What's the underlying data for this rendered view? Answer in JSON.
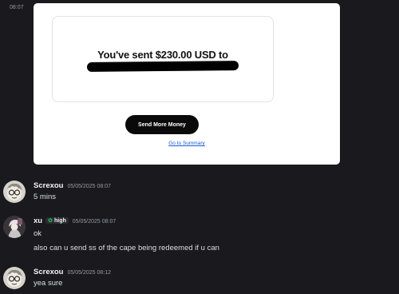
{
  "attachment": {
    "gutter_time": "08:07",
    "sent_text": "You've sent $230.00 USD to",
    "send_more_label": "Send More Money",
    "summary_link": "Go to Summary",
    "icon": "app-grid-icon"
  },
  "messages": [
    {
      "author": "Screxou",
      "timestamp": "05/05/2025 08:07",
      "lines": [
        "5 mins"
      ]
    },
    {
      "author": "xu",
      "tag": "high",
      "timestamp": "05/05/2025 08:07",
      "lines": [
        "ok",
        "also can u send ss of the cape being redeemed if u can"
      ]
    },
    {
      "author": "Screxou",
      "timestamp": "05/05/2025 08:12",
      "lines": [
        "yea sure"
      ]
    }
  ],
  "colors": {
    "background": "#1a1a1e",
    "username": "#f2f3f5",
    "timestamp": "#949ba4",
    "link": "#1a5ad6",
    "tag_leaf": "#23a559"
  }
}
